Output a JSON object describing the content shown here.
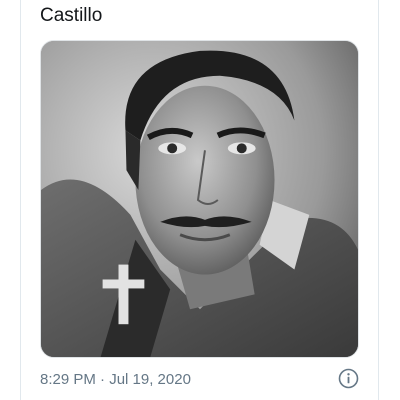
{
  "tweet": {
    "text": "Castillo",
    "timestamp": "8:29 PM · Jul 19, 2020"
  },
  "media": {
    "kind": "black-and-white portrait photograph"
  },
  "icons": {
    "info": "info-icon"
  },
  "colors": {
    "text_primary": "#14171a",
    "text_secondary": "#657786",
    "divider": "#e1e8ed"
  }
}
